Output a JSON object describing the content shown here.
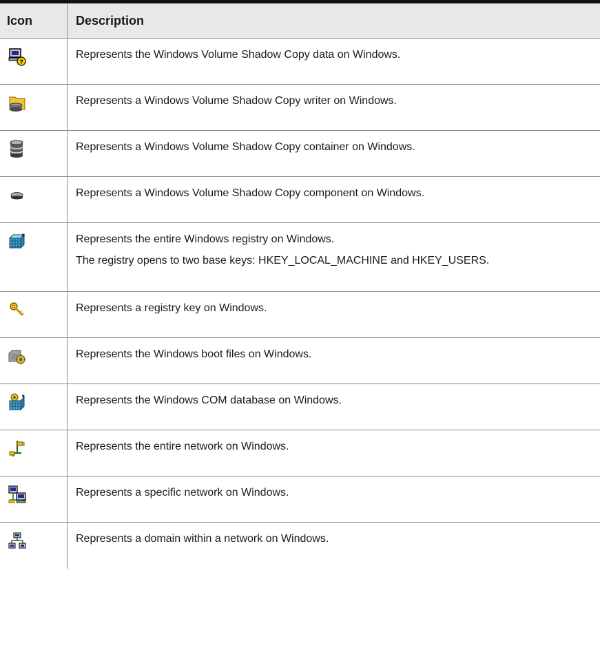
{
  "table": {
    "header": {
      "icon": "Icon",
      "description": "Description"
    },
    "rows": [
      {
        "icon": "vss-data-icon",
        "text": "Represents the Windows Volume Shadow Copy data on Windows."
      },
      {
        "icon": "vss-writer-icon",
        "text": "Represents a Windows Volume Shadow Copy writer on Windows."
      },
      {
        "icon": "vss-container-icon",
        "text": "Represents a Windows Volume Shadow Copy container on Windows."
      },
      {
        "icon": "vss-component-icon",
        "text": "Represents a Windows Volume Shadow Copy component on Windows."
      },
      {
        "icon": "registry-icon",
        "text": "Represents the entire Windows registry on Windows.",
        "text2": "The registry opens to two base keys: HKEY_LOCAL_MACHINE and HKEY_USERS."
      },
      {
        "icon": "registry-key-icon",
        "text": "Represents a registry key on Windows."
      },
      {
        "icon": "boot-files-icon",
        "text": "Represents the Windows boot files on Windows."
      },
      {
        "icon": "com-database-icon",
        "text": "Represents the Windows COM database on Windows."
      },
      {
        "icon": "entire-network-icon",
        "text": "Represents the entire network on Windows."
      },
      {
        "icon": "specific-network-icon",
        "text": "Represents a specific network on Windows."
      },
      {
        "icon": "domain-icon",
        "text": "Represents a domain within a network on Windows."
      }
    ]
  }
}
